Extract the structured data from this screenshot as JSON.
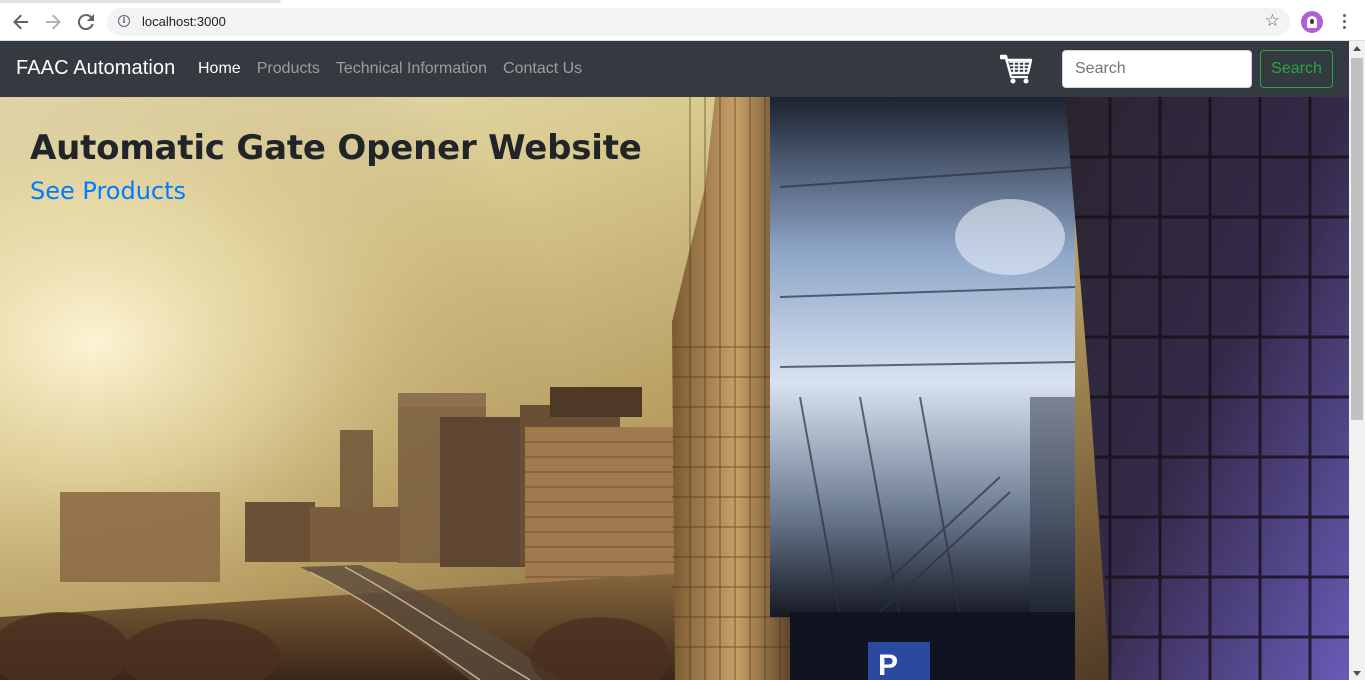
{
  "browser": {
    "url": "localhost:3000",
    "back_icon": "arrow-left-icon",
    "forward_icon": "arrow-right-icon",
    "reload_icon": "reload-icon",
    "info_icon": "info-icon",
    "bookmark_icon": "star-icon",
    "profile_icon": "profile-avatar-icon",
    "menu_icon": "kebab-menu-icon"
  },
  "navbar": {
    "brand": "FAAC Automation",
    "links": [
      {
        "label": "Home",
        "active": true
      },
      {
        "label": "Products",
        "active": false
      },
      {
        "label": "Technical Information",
        "active": false
      },
      {
        "label": "Contact Us",
        "active": false
      }
    ],
    "cart_icon": "shopping-cart-icon",
    "search_placeholder": "Search",
    "search_button": "Search"
  },
  "hero": {
    "title": "Automatic Gate Opener Website",
    "link": "See Products"
  },
  "colors": {
    "navbar_bg": "#343a40",
    "link_blue": "#007bff",
    "search_green": "#28a745",
    "title_dark": "#212529"
  }
}
